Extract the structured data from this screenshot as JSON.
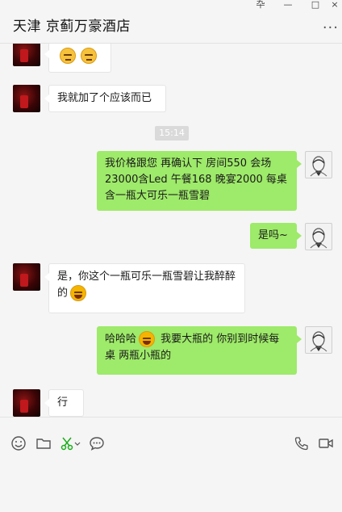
{
  "header": {
    "title": "天津 京蓟万豪酒店",
    "window_controls": [
      "卆",
      "—",
      "□",
      "×"
    ],
    "more": "···"
  },
  "messages": [
    {
      "side": "in",
      "avatar": "contact-avatar",
      "kind": "emoji",
      "emojis": [
        "unamused-emoji",
        "unamused-emoji"
      ]
    },
    {
      "side": "in",
      "avatar": "contact-avatar",
      "text": "我就加了个应该而已"
    },
    {
      "side": "out",
      "avatar": "self-avatar",
      "text": "我价格跟您 再确认下   房间550  会场23000含Led   午餐168   晚宴2000  每桌含一瓶大可乐一瓶雪碧"
    },
    {
      "side": "out",
      "avatar": "self-avatar",
      "text": "是吗~"
    },
    {
      "side": "in",
      "avatar": "contact-avatar",
      "text": "是，你这个一瓶可乐一瓶雪碧让我醉醉的",
      "emojis": [
        "laughing-crying-emoji"
      ]
    },
    {
      "side": "out",
      "avatar": "self-avatar",
      "text_a": "哈哈哈",
      "text_b": "我要大瓶的  你别到时候每桌 两瓶小瓶的",
      "emojis": [
        "laughing-crying-emoji"
      ]
    },
    {
      "side": "in",
      "avatar": "contact-avatar",
      "text": "行"
    }
  ],
  "timestamp": "15:14",
  "toolbar": {
    "left_icons": [
      "emoji-icon",
      "folder-icon",
      "scissors-icon",
      "chat-bubble-icon"
    ],
    "right_icons": [
      "phone-icon",
      "video-call-icon"
    ]
  },
  "colors": {
    "outgoing_bubble": "#9eea6a",
    "incoming_bubble": "#ffffff",
    "background": "#f5f5f5",
    "accent_scissors": "#1aad19"
  }
}
